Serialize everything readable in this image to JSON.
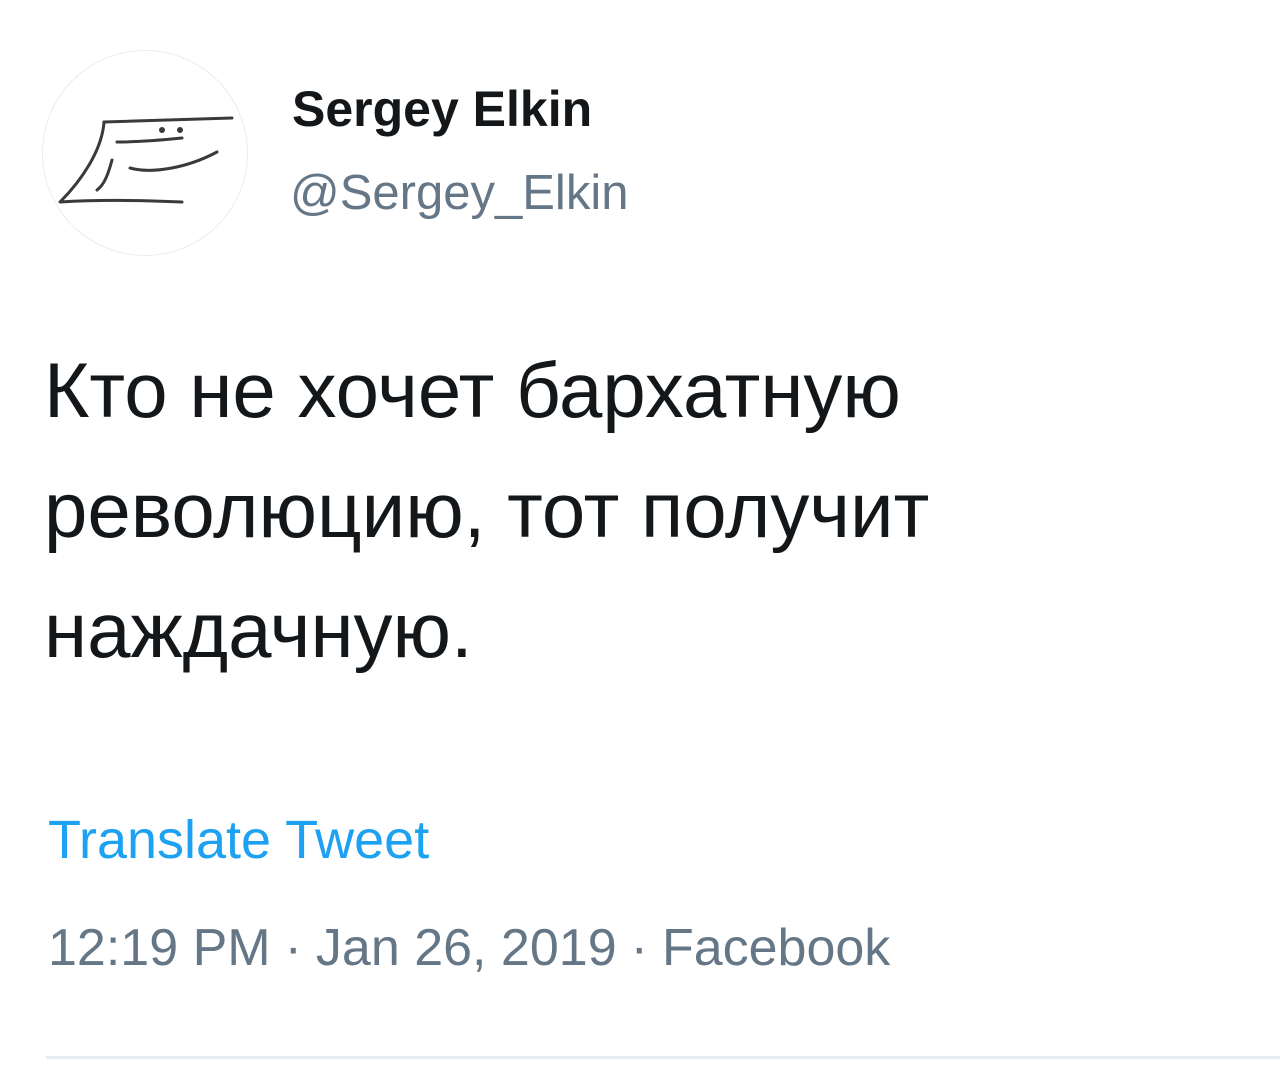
{
  "author": {
    "display_name": "Sergey Elkin",
    "handle": "@Sergey_Elkin",
    "avatar_icon": "hand-drawn-iron-face-avatar"
  },
  "tweet": {
    "text_lines": [
      "Кто не хочет бархатную",
      "революцию, тот получит",
      "наждачную."
    ],
    "translate_label": "Translate Tweet",
    "time": "12:19 PM",
    "date": "Jan 26, 2019",
    "source": "Facebook",
    "separator": "·"
  },
  "colors": {
    "text": "#14171a",
    "secondary": "#657786",
    "link": "#1da1f2",
    "divider": "#e6ecf0"
  }
}
